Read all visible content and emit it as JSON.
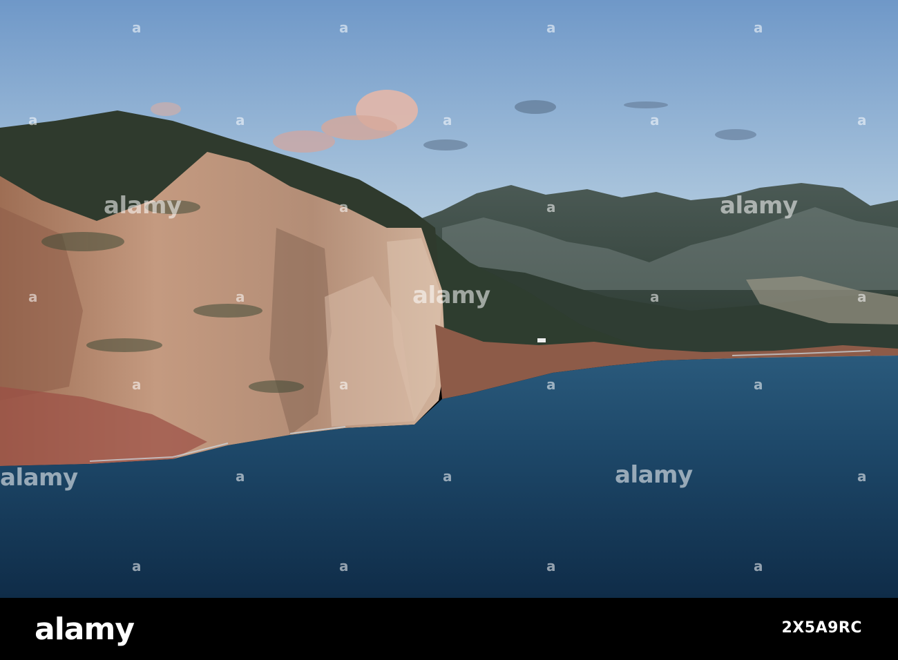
{
  "image": {
    "subject": "coastal-cliffs-seascape",
    "colors": {
      "sky_top": "#6f98c8",
      "sky_bottom": "#c3d8e6",
      "sea": "#183f62",
      "cliff": "#b8937a",
      "mountain": "#3d4a40"
    }
  },
  "watermark": {
    "text": "alamy",
    "small_glyph": "a"
  },
  "footer": {
    "logo": "alamy",
    "image_id": "2X5A9RC"
  }
}
